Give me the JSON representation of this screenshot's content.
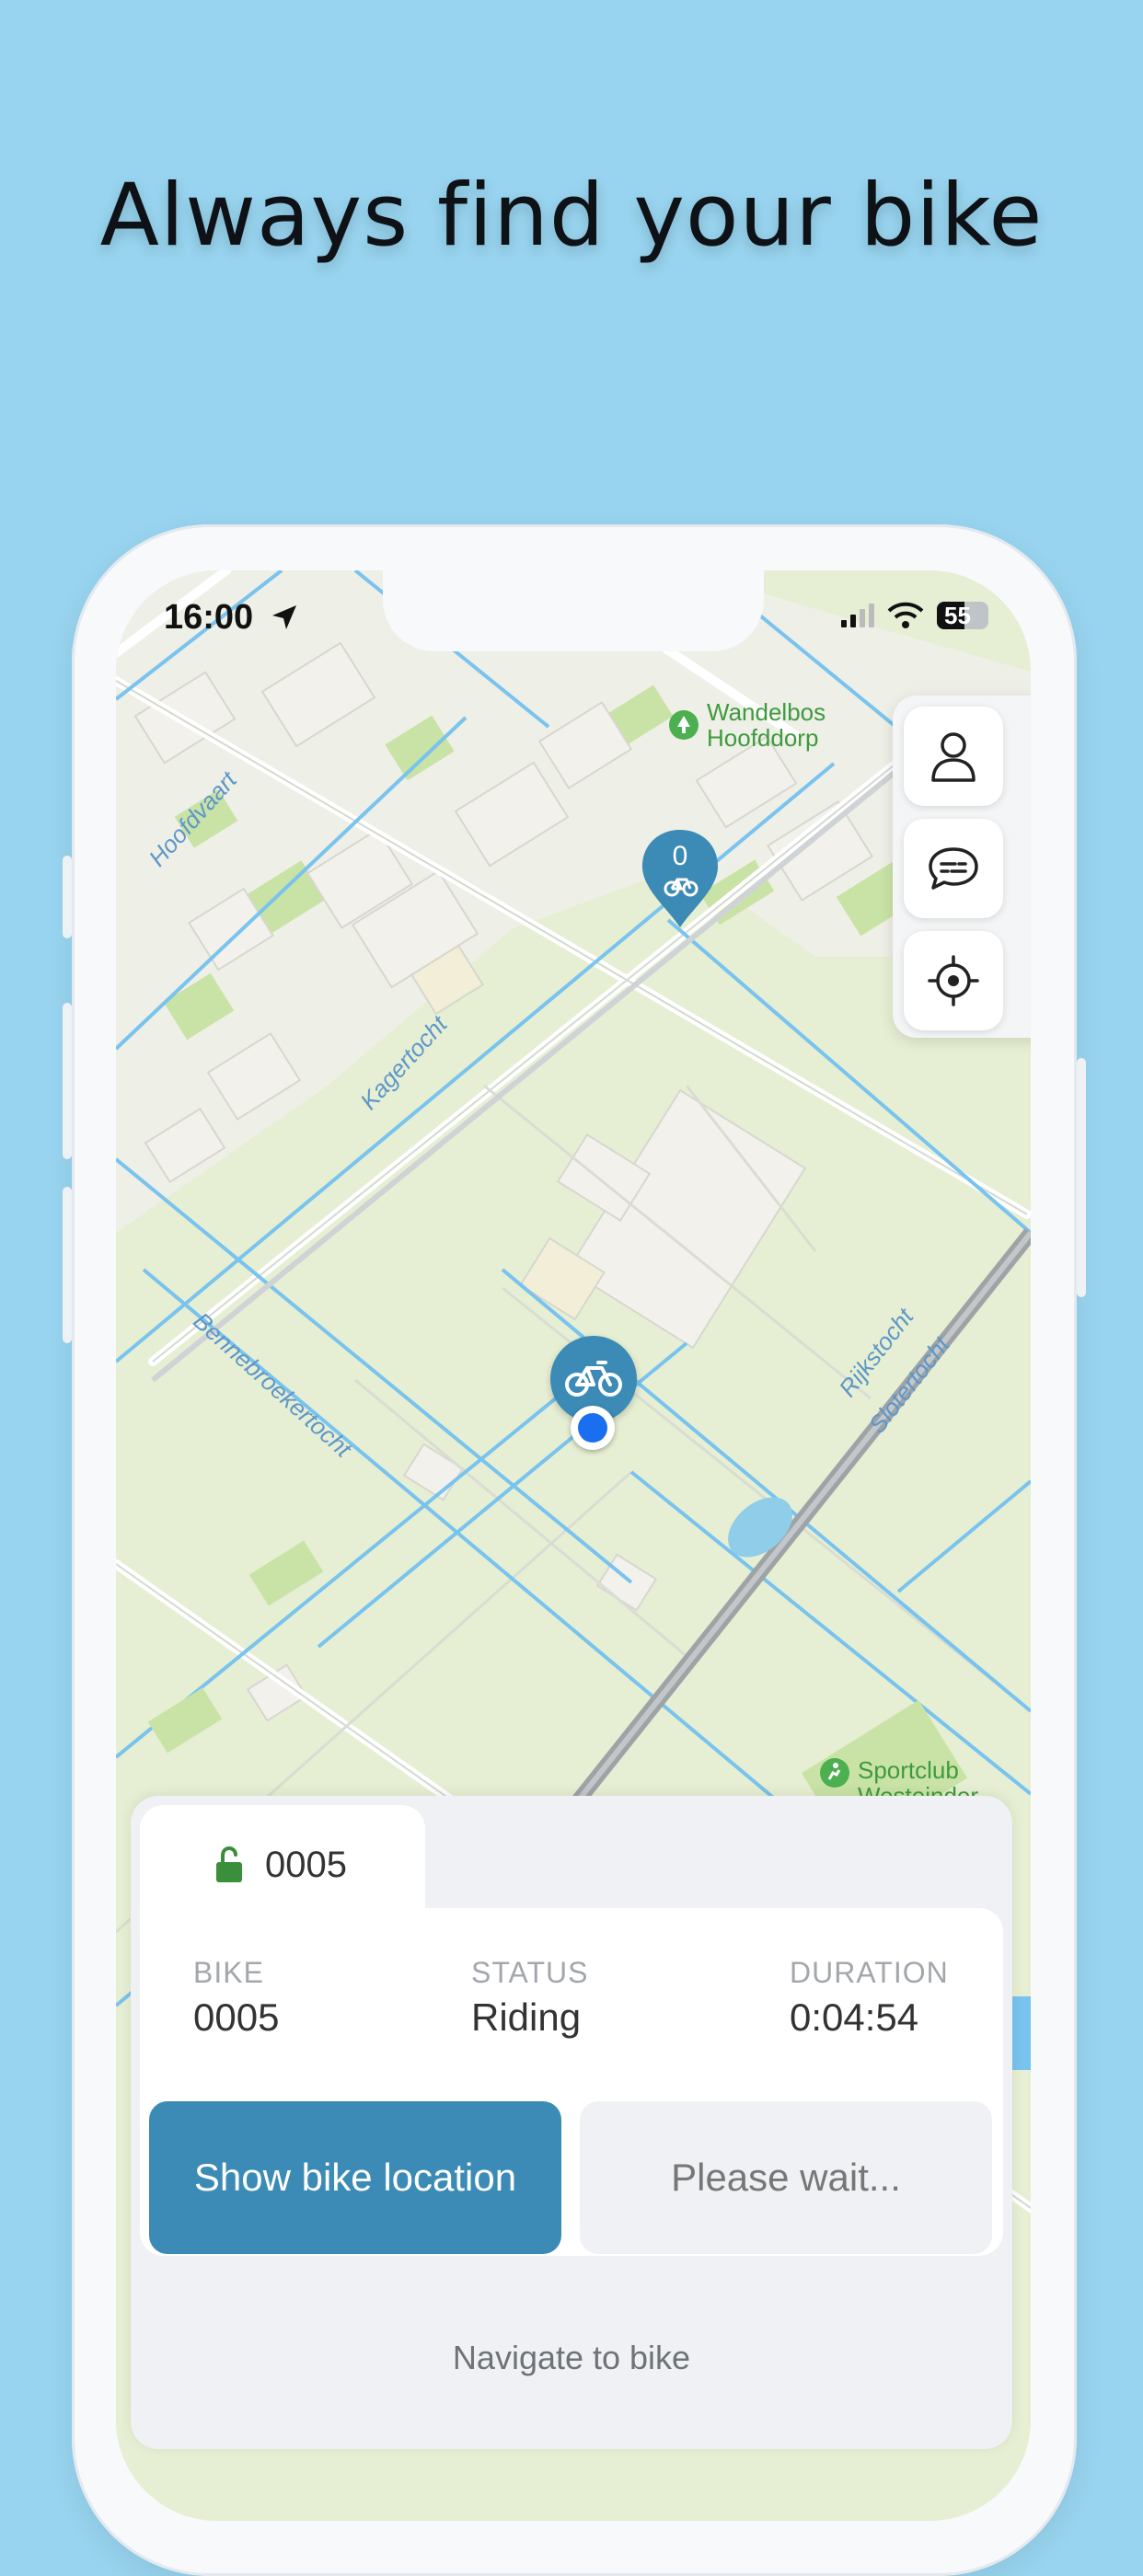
{
  "headline": "Always find your bike",
  "status_bar": {
    "time": "16:00",
    "battery": "55"
  },
  "map": {
    "labels": {
      "hoofdvaart": "Hoofdvaart",
      "kagertocht": "Kagertocht",
      "bennebroekertocht": "Bennebroekertocht",
      "rijkstocht": "Rijkstocht",
      "slotertocht": "Slotertocht"
    },
    "poi": {
      "wandelbos": [
        "Wandelbos",
        "Hoofddorp"
      ],
      "sportclub": [
        "Sportclub",
        "Westeinder"
      ]
    },
    "cluster_count": "0"
  },
  "map_controls": [
    "profile-icon",
    "chat-icon",
    "locate-icon"
  ],
  "ride_panel": {
    "tab_label": "0005",
    "info": {
      "bike_key": "BIKE",
      "bike_val": "0005",
      "status_key": "STATUS",
      "status_val": "Riding",
      "duration_key": "DURATION",
      "duration_val": "0:04:54"
    },
    "primary_button": "Show bike location",
    "secondary_button": "Please wait...",
    "navigate_link": "Navigate to bike"
  },
  "colors": {
    "background": "#98d4ef",
    "accent": "#3b8bb6",
    "lock_green": "#3a8f3a",
    "map_land": "#e7efd5",
    "map_water": "#79c3ef"
  }
}
